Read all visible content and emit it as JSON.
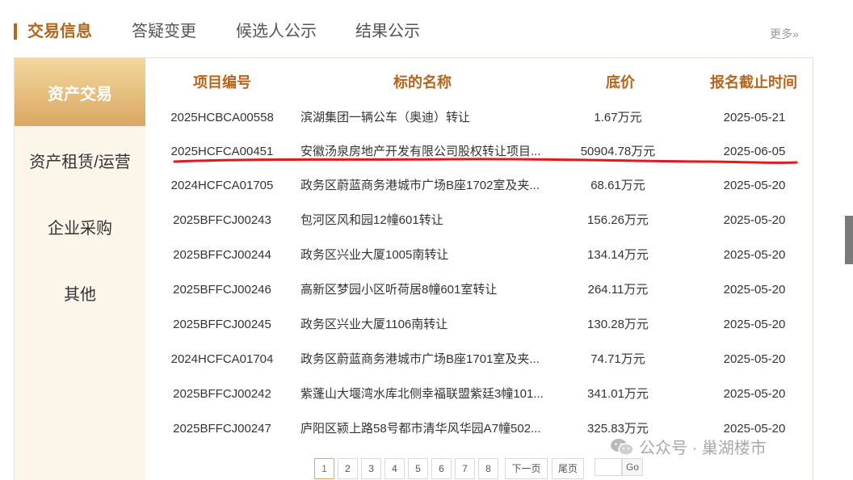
{
  "tabs": [
    {
      "label": "交易信息",
      "active": true
    },
    {
      "label": "答疑变更",
      "active": false
    },
    {
      "label": "候选人公示",
      "active": false
    },
    {
      "label": "结果公示",
      "active": false
    }
  ],
  "more_label": "更多»",
  "sidebar": {
    "items": [
      {
        "label": "资产交易",
        "active": true
      },
      {
        "label": "资产租赁/运营",
        "active": false
      },
      {
        "label": "企业采购",
        "active": false
      },
      {
        "label": "其他",
        "active": false
      }
    ]
  },
  "table": {
    "headers": {
      "code": "项目编号",
      "name": "标的名称",
      "price": "底价",
      "deadline": "报名截止时间"
    },
    "rows": [
      {
        "code": "2025HCBCA00558",
        "name": "滨湖集团一辆公车（奥迪）转让",
        "price": "1.67万元",
        "deadline": "2025-05-21"
      },
      {
        "code": "2025HCFCA00451",
        "name": "安徽汤泉房地产开发有限公司股权转让项目...",
        "price": "50904.78万元",
        "deadline": "2025-06-05"
      },
      {
        "code": "2024HCFCA01705",
        "name": "政务区蔚蓝商务港城市广场B座1702室及夹...",
        "price": "68.61万元",
        "deadline": "2025-05-20"
      },
      {
        "code": "2025BFFCJ00243",
        "name": "包河区风和园12幢601转让",
        "price": "156.26万元",
        "deadline": "2025-05-20"
      },
      {
        "code": "2025BFFCJ00244",
        "name": "政务区兴业大厦1005南转让",
        "price": "134.14万元",
        "deadline": "2025-05-20"
      },
      {
        "code": "2025BFFCJ00246",
        "name": "高新区梦园小区听荷居8幢601室转让",
        "price": "264.11万元",
        "deadline": "2025-05-20"
      },
      {
        "code": "2025BFFCJ00245",
        "name": "政务区兴业大厦1106南转让",
        "price": "130.28万元",
        "deadline": "2025-05-20"
      },
      {
        "code": "2024HCFCA01704",
        "name": "政务区蔚蓝商务港城市广场B座1701室及夹...",
        "price": "74.71万元",
        "deadline": "2025-05-20"
      },
      {
        "code": "2025BFFCJ00242",
        "name": "紫蓬山大堰湾水库北侧幸福联盟紫廷3幢101...",
        "price": "341.01万元",
        "deadline": "2025-05-20"
      },
      {
        "code": "2025BFFCJ00247",
        "name": "庐阳区颍上路58号都市清华风华园A7幢502...",
        "price": "325.83万元",
        "deadline": "2025-05-20"
      }
    ]
  },
  "pagination": {
    "pages": [
      "1",
      "2",
      "3",
      "4",
      "5",
      "6",
      "7",
      "8"
    ],
    "current": "1",
    "next_label": "下一页",
    "last_label": "尾页",
    "go_label": "Go"
  },
  "watermark": {
    "text": "公众号 · 巢湖楼市"
  },
  "colors": {
    "accent": "#b5651d",
    "annotation": "#e0191b",
    "sidebar_active": "#d9a862"
  }
}
